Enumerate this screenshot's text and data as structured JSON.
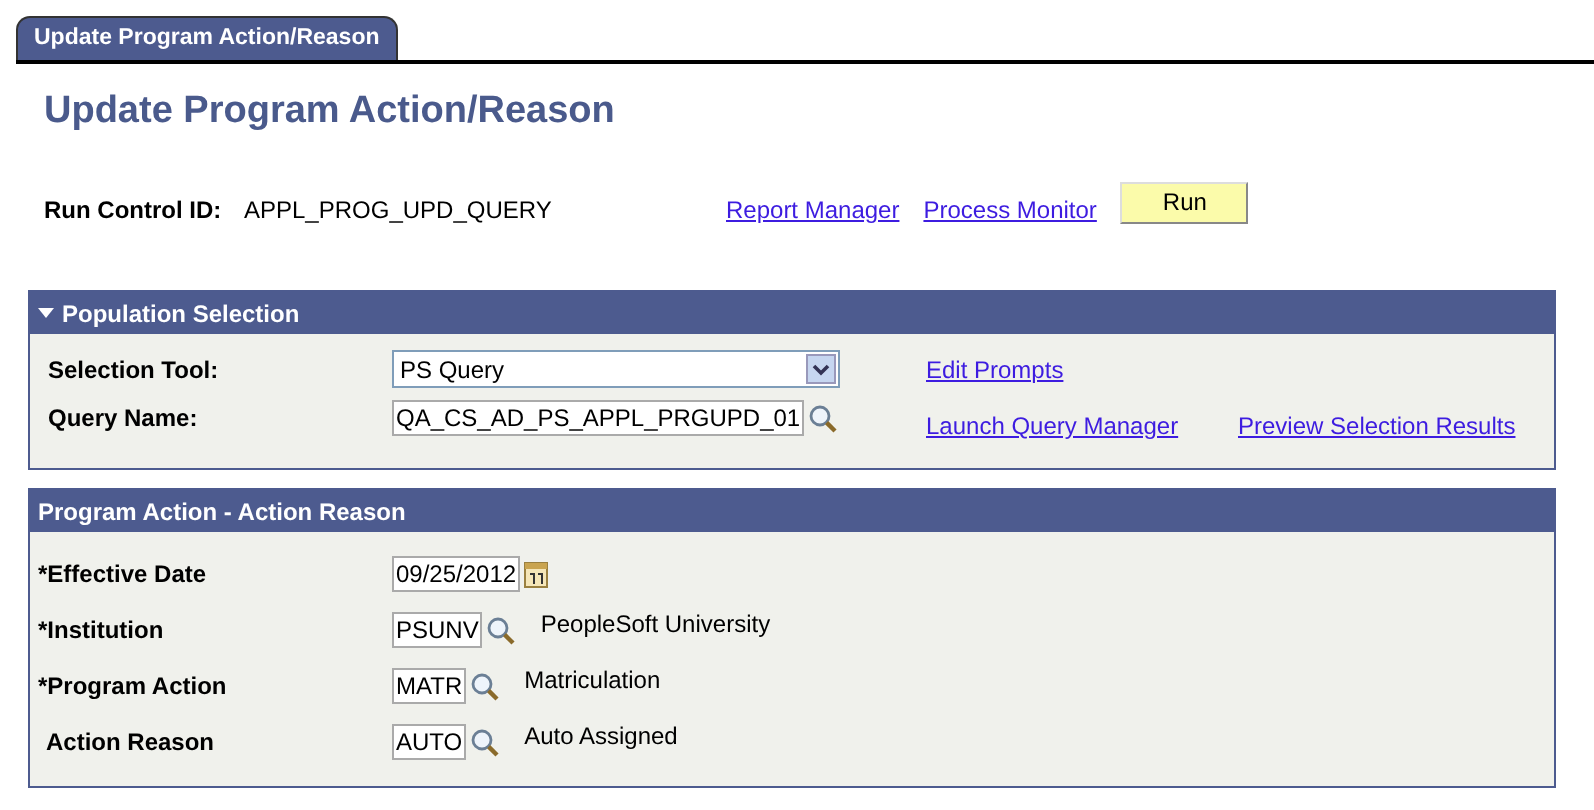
{
  "tabs": [
    {
      "label": "Update Program Action/Reason",
      "selected": true
    }
  ],
  "title": "Update Program Action/Reason",
  "run_control": {
    "label": "Run Control ID:",
    "value": "APPL_PROG_UPD_QUERY"
  },
  "links": [
    "Report Manager",
    "Process Monitor"
  ],
  "run_button": "Run",
  "population": {
    "title": "Population Selection",
    "expanded": true,
    "fields": [
      {
        "kind": "select",
        "label": "Selection Tool:",
        "value": "PS Query"
      },
      {
        "kind": "lookup",
        "label": "Query Name:",
        "value": "QA_CS_AD_PS_APPL_PRGUPD_01"
      }
    ],
    "links": [
      "Edit Prompts",
      "Launch Query Manager",
      "Preview Selection Results"
    ]
  },
  "program_action": {
    "title": "Program Action - Action Reason",
    "fields": [
      {
        "kind": "date",
        "label": "*Effective Date",
        "value": "09/25/2012"
      },
      {
        "kind": "lookup",
        "label": "*Institution",
        "value": "PSUNV",
        "description": "PeopleSoft University"
      },
      {
        "kind": "lookup",
        "label": "*Program Action",
        "value": "MATR",
        "description": "Matriculation"
      },
      {
        "kind": "lookup",
        "label": "Action Reason",
        "value": "AUTO",
        "description": "Auto Assigned"
      }
    ]
  }
}
